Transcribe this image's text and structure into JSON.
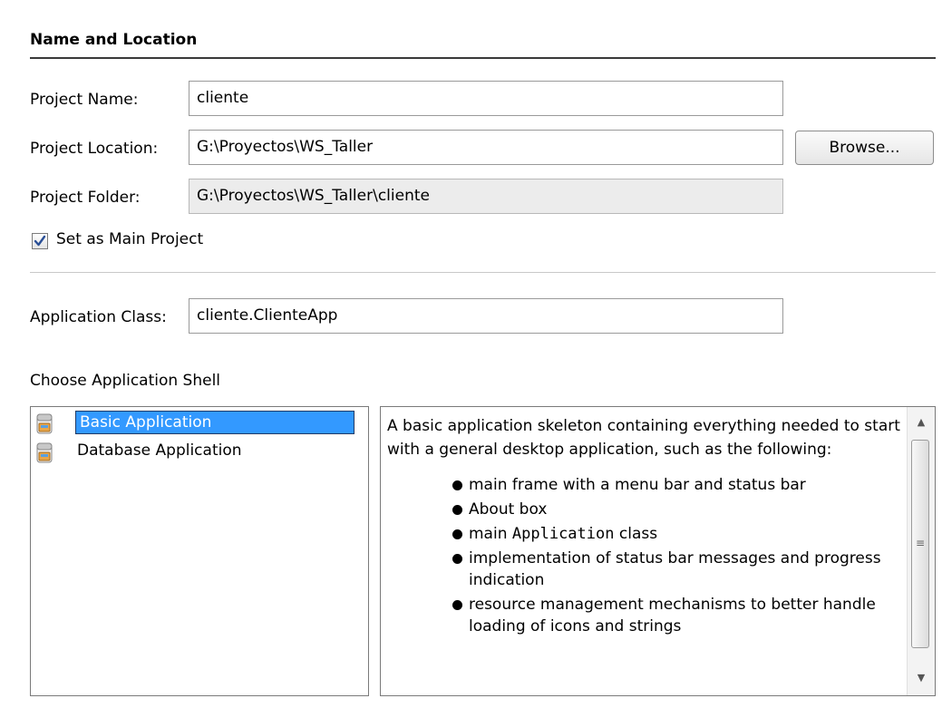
{
  "section": {
    "title": "Name and Location"
  },
  "project": {
    "name_label": "Project Name:",
    "name_value": "cliente",
    "location_label": "Project Location:",
    "location_value": "G:\\Proyectos\\WS_Taller",
    "browse_label": "Browse...",
    "folder_label": "Project Folder:",
    "folder_value": "G:\\Proyectos\\WS_Taller\\cliente",
    "main_project_label": "Set as Main Project",
    "main_project_checked": true
  },
  "application": {
    "class_label": "Application Class:",
    "class_value": "cliente.ClienteApp",
    "shell_label": "Choose Application Shell"
  },
  "shells": [
    {
      "label": "Basic Application",
      "selected": true
    },
    {
      "label": "Database Application",
      "selected": false
    }
  ],
  "description": {
    "intro": "A basic application skeleton containing everything needed to start with a general desktop application, such as the following:",
    "bullets": [
      {
        "text": "main frame with a menu bar and status bar"
      },
      {
        "text": "About box"
      },
      {
        "pre": "main ",
        "code": "Application",
        "post": " class"
      },
      {
        "text": "implementation of status bar messages and progress indication"
      },
      {
        "text": "resource management mechanisms to better handle loading of icons and strings"
      }
    ]
  },
  "colors": {
    "selection": "#3399ff",
    "readonly_bg": "#ececec"
  },
  "icons": {
    "shell_item": "application-shell-icon",
    "checkmark": "checkmark-icon"
  }
}
